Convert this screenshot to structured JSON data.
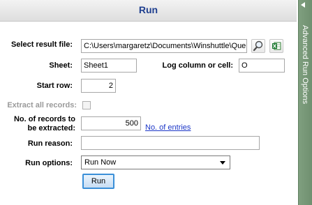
{
  "header": {
    "title": "Run"
  },
  "side_panel": {
    "label": "Advanced Run Options"
  },
  "form": {
    "result_file_label": "Select result file:",
    "result_file_value": "C:\\Users\\margaretz\\Documents\\Winshuttle\\Que",
    "sheet_label": "Sheet:",
    "sheet_value": "Sheet1",
    "log_label": "Log column or cell:",
    "log_value": "O",
    "start_row_label": "Start row:",
    "start_row_value": "2",
    "extract_all_label": "Extract all records:",
    "extract_all_checked": false,
    "num_records_label_line1": "No. of records to",
    "num_records_label_line2": "be extracted:",
    "num_records_value": "500",
    "no_entries_link": "No. of entries",
    "run_reason_label": "Run reason:",
    "run_reason_value": "",
    "run_options_label": "Run options:",
    "run_options_selected": "Run Now",
    "run_button": "Run"
  },
  "icons": [
    "search-icon",
    "excel-icon",
    "collapse-arrow-icon",
    "chevron-down-icon"
  ],
  "colors": {
    "title": "#1f3f8f",
    "side_panel": "#7f9f7f",
    "link": "#1a35c7",
    "run_button_border": "#3a8fd8"
  }
}
